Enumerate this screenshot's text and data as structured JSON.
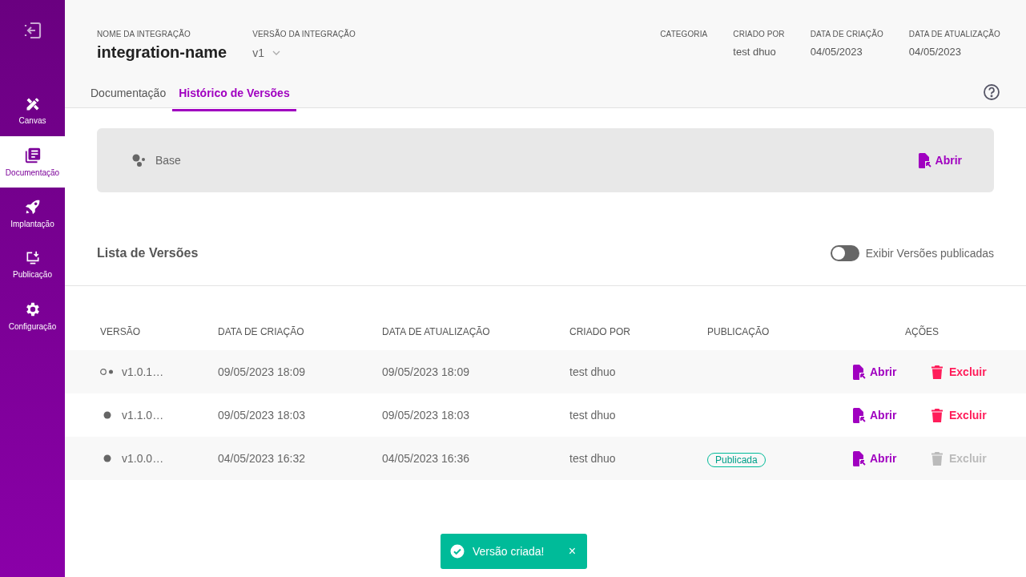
{
  "sidebar": {
    "items": [
      {
        "label": "Canvas",
        "selected": false
      },
      {
        "label": "Documentação",
        "selected": true
      },
      {
        "label": "Implantação",
        "selected": false
      },
      {
        "label": "Publicação",
        "selected": false
      },
      {
        "label": "Configuração",
        "selected": false
      }
    ]
  },
  "header": {
    "name_label": "NOME DA INTEGRAÇÃO",
    "name": "integration-name",
    "version_label": "VERSÃO DA INTEGRAÇÃO",
    "version": "v1",
    "meta": [
      {
        "label": "CATEGORIA"
      },
      {
        "label": "CRIADO POR",
        "value": "test dhuo"
      },
      {
        "label": "DATA DE CRIAÇÃO",
        "value": "04/05/2023"
      },
      {
        "label": "DATA DE ATUALIZAÇÃO",
        "value": "04/05/2023"
      }
    ]
  },
  "tabs": [
    {
      "label": "Documentação",
      "selected": false
    },
    {
      "label": "Histórico de Versões",
      "selected": true
    }
  ],
  "base": {
    "label": "Base",
    "action": "Abrir"
  },
  "versions": {
    "title": "Lista de Versões",
    "toggle": {
      "label": "Exibir Versões publicadas",
      "on": false
    },
    "columns": [
      "VERSÃO",
      "DATA DE CRIAÇÃO",
      "DATA DE ATUALIZAÇÃO",
      "CRIADO POR",
      "PUBLICAÇÃO",
      "AÇÕES"
    ],
    "rows": [
      {
        "kind": "branch",
        "version": "v1.0.1…",
        "created": "09/05/2023 18:09",
        "updated": "09/05/2023 18:09",
        "author": "test dhuo",
        "open": "Abrir",
        "delete": "Excluir",
        "delete_disabled": false
      },
      {
        "kind": "single",
        "version": "v1.1.0…",
        "created": "09/05/2023 18:03",
        "updated": "09/05/2023 18:03",
        "author": "test dhuo",
        "open": "Abrir",
        "delete": "Excluir",
        "delete_disabled": false
      },
      {
        "kind": "single",
        "version": "v1.0.0…",
        "created": "04/05/2023 16:32",
        "updated": "04/05/2023 16:36",
        "author": "test dhuo",
        "publication": "Publicada",
        "open": "Abrir",
        "delete": "Excluir",
        "delete_disabled": true
      }
    ]
  },
  "toast": {
    "message": "Versão criada!",
    "close": "×"
  }
}
